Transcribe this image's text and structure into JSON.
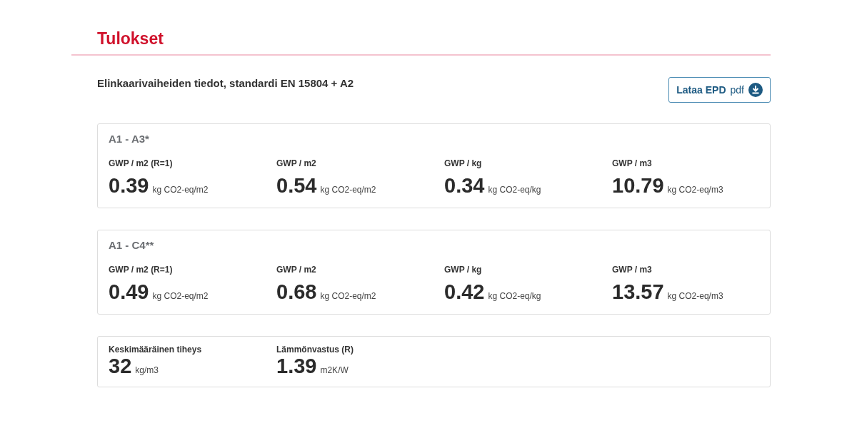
{
  "title": "Tulokset",
  "subtitle": "Elinkaarivaiheiden tiedot, standardi EN 15804 + A2",
  "download_button": {
    "label": "Lataa EPD",
    "suffix": "pdf"
  },
  "stages": [
    {
      "title": "A1 - A3*",
      "metrics": [
        {
          "label": "GWP / m2 (R=1)",
          "value": "0.39",
          "unit": "kg CO2-eq/m2"
        },
        {
          "label": "GWP / m2",
          "value": "0.54",
          "unit": "kg CO2-eq/m2"
        },
        {
          "label": "GWP / kg",
          "value": "0.34",
          "unit": "kg CO2-eq/kg"
        },
        {
          "label": "GWP / m3",
          "value": "10.79",
          "unit": "kg CO2-eq/m3"
        }
      ]
    },
    {
      "title": "A1 - C4**",
      "metrics": [
        {
          "label": "GWP / m2 (R=1)",
          "value": "0.49",
          "unit": "kg CO2-eq/m2"
        },
        {
          "label": "GWP / m2",
          "value": "0.68",
          "unit": "kg CO2-eq/m2"
        },
        {
          "label": "GWP / kg",
          "value": "0.42",
          "unit": "kg CO2-eq/kg"
        },
        {
          "label": "GWP / m3",
          "value": "13.57",
          "unit": "kg CO2-eq/m3"
        }
      ]
    }
  ],
  "properties": [
    {
      "label": "Keskimääräinen tiheys",
      "value": "32",
      "unit": "kg/m3"
    },
    {
      "label": "Lämmönvastus (R)",
      "value": "1.39",
      "unit": "m2K/W"
    }
  ]
}
